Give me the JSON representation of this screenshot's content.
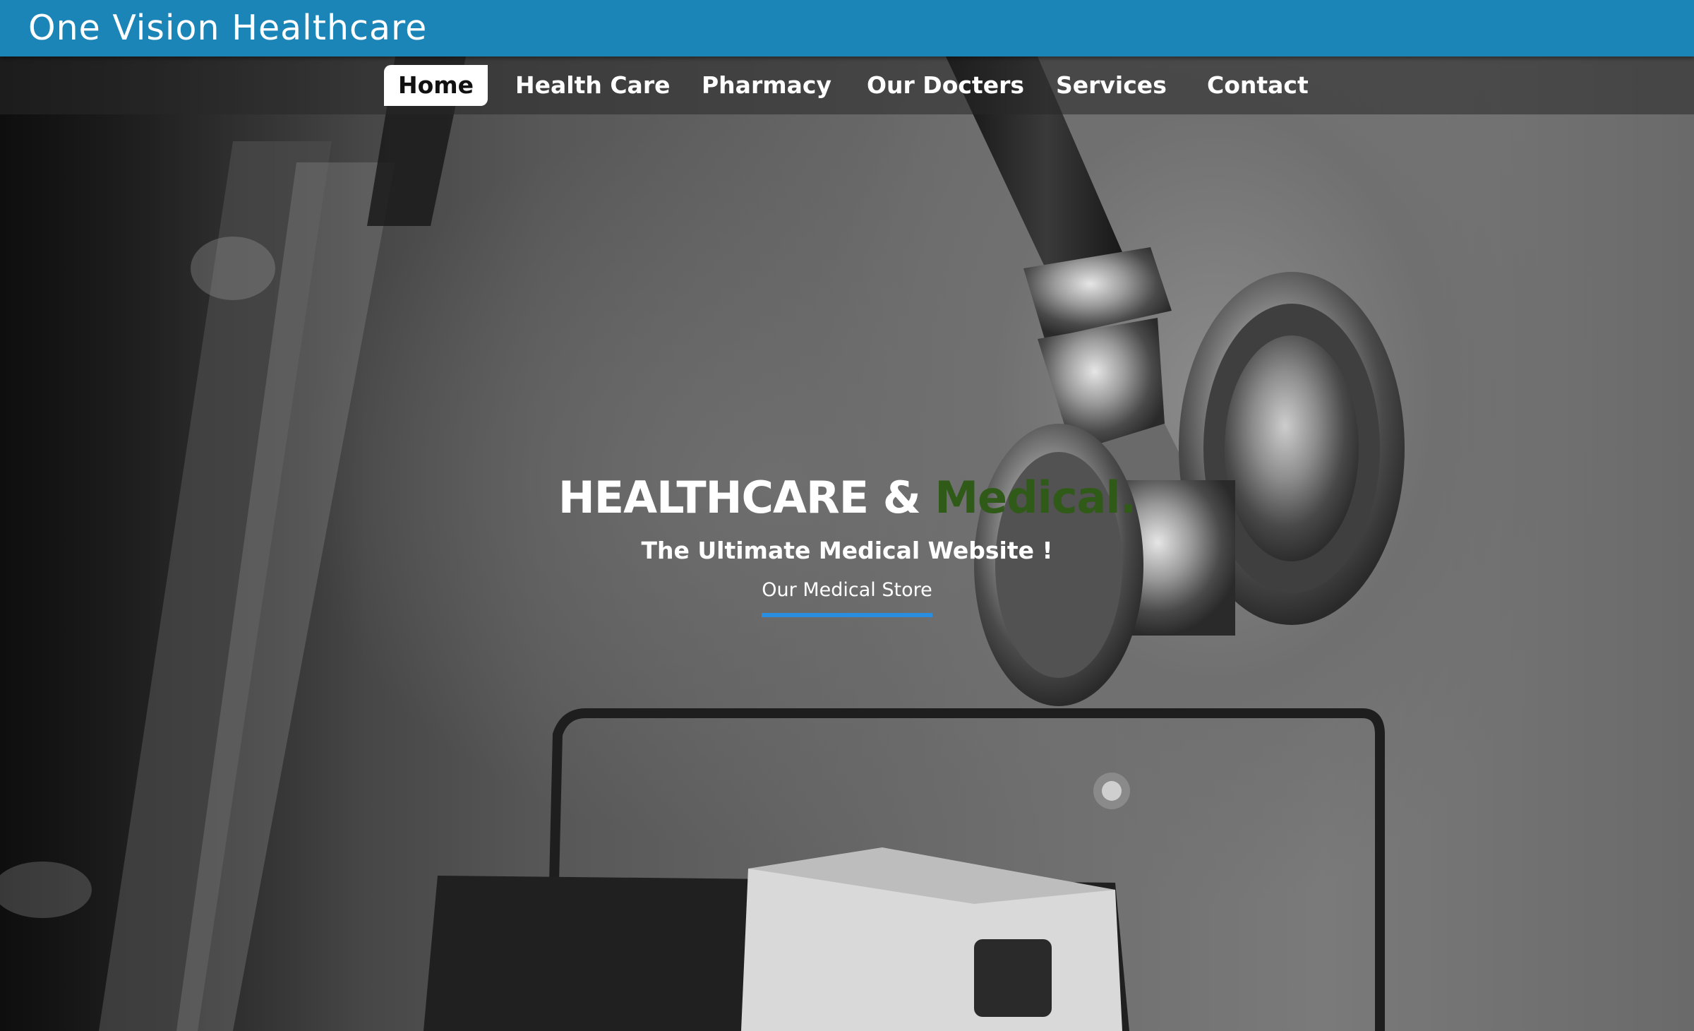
{
  "header": {
    "brand": "One Vision Healthcare"
  },
  "nav": {
    "items": [
      {
        "label": "Home",
        "active": true
      },
      {
        "label": "Health Care",
        "active": false
      },
      {
        "label": "Pharmacy",
        "active": false
      },
      {
        "label": "Our Docters",
        "active": false
      },
      {
        "label": "Services",
        "active": false
      },
      {
        "label": "Contact",
        "active": false
      }
    ]
  },
  "hero": {
    "headline_main": "HEALTHCARE & ",
    "headline_accent": "Medical.",
    "tagline": "The Ultimate Medical Website !",
    "store_link": "Our Medical Store"
  },
  "colors": {
    "topbar": "#1b85b8",
    "accent_text": "#2f5a17",
    "link_underline": "#2a8ee0",
    "nav_active_bg": "#ffffff"
  }
}
